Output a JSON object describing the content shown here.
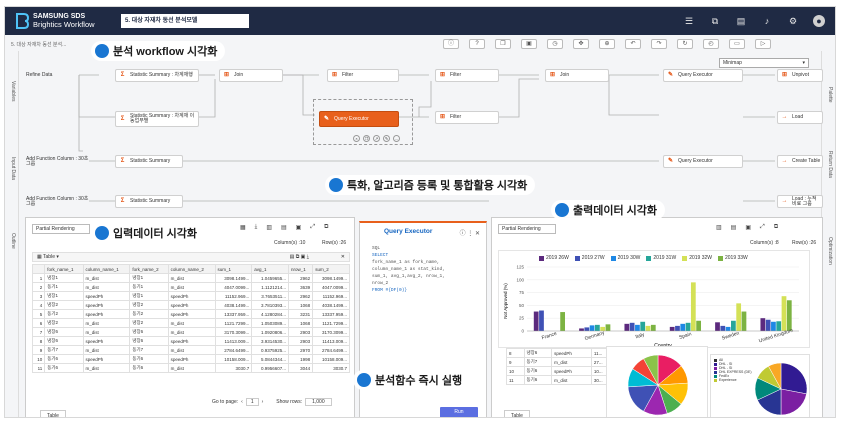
{
  "header": {
    "brand_line1": "SAMSUNG SDS",
    "brand_line2": "Brightics Workflow",
    "workflow_title": "5. 대상 자재차 동선 분석모델",
    "icons": [
      "grid-icon",
      "external-link-icon",
      "document-icon",
      "bell-icon",
      "settings-icon",
      "user-icon"
    ]
  },
  "breadcrumb": "5. 대상 자재차 동선 분석...",
  "minimap": {
    "label": "Minimap"
  },
  "side_left": [
    "Variables",
    "Input Data",
    "Outline"
  ],
  "side_right": [
    "Palette",
    "Return Data",
    "Optimization"
  ],
  "nodes": {
    "n1": "Refine Data",
    "n2": "Statistic Summary : 차계재행",
    "n3": "Join",
    "n4": "Filter",
    "n5": "Filter",
    "n6": "Join",
    "n7": "Query Executor",
    "n8": "Unpivot",
    "n9": "Statistic Summary : 차계재 이동업무별",
    "n10": "Query Executor",
    "n11": "Filter",
    "n12": "Load",
    "n13": "Add Function Column : 30초 그룹",
    "n14": "Statistic Summary",
    "n15": "Query Executor",
    "n16": "Create Table",
    "n17": "Add Function Column : 30초 그룹",
    "n18": "Statistic Summary",
    "n19": "Load : 누적 비료 그룹"
  },
  "banners": {
    "workflow": "분석 workflow 시각화",
    "algorithm": "특화, 알고리즘 등록 및 통합활용 시각화",
    "input": "입력데이터 시각화",
    "output": "출력데이터 시각화",
    "execute": "분석함수 즉시 실행"
  },
  "input_panel": {
    "render_mode": "Partial Rendering",
    "column_count": "Column(s) :10",
    "row_count": "Row(s) :26",
    "table_label": "Table",
    "columns": [
      "",
      "fork_name_1",
      "column_name_1",
      "fork_name_2",
      "column_name_2",
      "sum_1",
      "avg_1",
      "nrow_1",
      "sum_2"
    ],
    "rows": [
      [
        "1",
        "냉장1",
        "m_dist",
        "냉장1",
        "m_dist",
        "3098.1499...",
        "1.0459655...",
        "2962",
        "3098.1499..."
      ],
      [
        "2",
        "동기1",
        "m_dist",
        "동기1",
        "m_dist",
        "4047.0099...",
        "1.1121214...",
        "3639",
        "4047.0099..."
      ],
      [
        "3",
        "냉장1",
        "speedPh",
        "냉장1",
        "speedPh",
        "11152.969...",
        "3.7653511...",
        "2962",
        "11152.969..."
      ],
      [
        "4",
        "냉장2",
        "speedPh",
        "냉장2",
        "speedPh",
        "4038.1499...",
        "3.7810393...",
        "1068",
        "4038.1499..."
      ],
      [
        "5",
        "동기2",
        "speedPh",
        "동기2",
        "speedPh",
        "13337.959...",
        "4.1280284...",
        "3231",
        "13337.959..."
      ],
      [
        "6",
        "냉장2",
        "m_dist",
        "냉장2",
        "m_dist",
        "1121.7299...",
        "1.0503089...",
        "1068",
        "1121.7299..."
      ],
      [
        "7",
        "냉장6",
        "m_dist",
        "냉장6",
        "m_dist",
        "3170.3099...",
        "1.0920806...",
        "2903",
        "3170.3099..."
      ],
      [
        "8",
        "냉장6",
        "speedPh",
        "냉장6",
        "speedPh",
        "11413.009...",
        "3.9314530...",
        "2903",
        "11413.009..."
      ],
      [
        "9",
        "동기7",
        "m_dist",
        "동기7",
        "m_dist",
        "2784.6499...",
        "0.9375925...",
        "2970",
        "2784.6499..."
      ],
      [
        "10",
        "동기6",
        "speedPh",
        "동기6",
        "speedPh",
        "10158.009...",
        "5.0844344...",
        "1998",
        "10158.009..."
      ],
      [
        "11",
        "동기6",
        "m_dist",
        "동기6",
        "m_dist",
        "3030.7",
        "0.9956607...",
        "3044",
        "3030.7"
      ]
    ],
    "go_to_page": "Go to page:",
    "page": "1",
    "show_rows": "Show rows:",
    "show_rows_value": "1,000",
    "bottom_tab": "Table"
  },
  "query_panel": {
    "title": "Query Executor",
    "sql": [
      "SQL",
      "SELECT",
      "  fork_name_1 as fork_name,",
      "  column_name_1 as stat_kind,",
      "  sum_1, avg_1,avg_2, nrow_1,",
      "  nrow_2",
      "FROM #{DF(0)}"
    ],
    "run_label": "Run"
  },
  "output_panel": {
    "render_mode": "Partial Rendering",
    "column_count": "Column(s) :8",
    "row_count": "Row(s) :26",
    "bottom_tab": "Table",
    "bg_rows": [
      [
        "8",
        "냉장6",
        "speedPh",
        "11..."
      ],
      [
        "9",
        "동기7",
        "m_dist",
        "27..."
      ],
      [
        "10",
        "동기6",
        "speedPh",
        "10..."
      ],
      [
        "11",
        "동기6",
        "m_dist",
        "30..."
      ]
    ]
  },
  "colors": {
    "header_bg": "#1f2a44",
    "accent": "#e8601c",
    "banner_dot": "#1976d2"
  },
  "chart_data": [
    {
      "type": "bar",
      "categories": [
        "France",
        "Germany",
        "Italy",
        "Spain",
        "Sweden",
        "United Kingdom"
      ],
      "series": [
        {
          "name": "2019 26W",
          "values": [
            38,
            5,
            14,
            8,
            17,
            25
          ],
          "color": "#5c2a7e"
        },
        {
          "name": "2019 27W",
          "values": [
            40,
            7,
            16,
            10,
            10,
            22
          ],
          "color": "#3f51b5"
        },
        {
          "name": "2019 30W",
          "values": [
            0,
            11,
            12,
            14,
            8,
            18
          ],
          "color": "#1e88e5"
        },
        {
          "name": "2019 31W",
          "values": [
            0,
            12,
            18,
            16,
            20,
            19
          ],
          "color": "#26a69a"
        },
        {
          "name": "2019 32W",
          "values": [
            0,
            8,
            10,
            95,
            54,
            68
          ],
          "color": "#d4e157"
        },
        {
          "name": "2019 33W",
          "values": [
            37,
            13,
            12,
            20,
            38,
            60
          ],
          "color": "#7cb342"
        }
      ],
      "xlabel": "Country",
      "ylabel": "Not Approved (%)",
      "ylim": [
        0,
        125
      ],
      "yticks": [
        "0",
        "25",
        "50",
        "75",
        "100",
        "125"
      ],
      "grid": true,
      "legend": "top"
    },
    {
      "type": "pie",
      "values": [
        14,
        10,
        12,
        9,
        13,
        16,
        10,
        8,
        8
      ],
      "colors": [
        "#e91e63",
        "#ff9800",
        "#ffc107",
        "#4caf50",
        "#9c27b0",
        "#3f51b5",
        "#00bcd4",
        "#f44336",
        "#8bc34a"
      ]
    },
    {
      "type": "pie",
      "legend_labels": [
        "All",
        "DHL - SI",
        "DHL - SI",
        "DHL EXPRESS (DE)",
        "FedEx",
        "Experience"
      ],
      "values": [
        28,
        22,
        18,
        14,
        10,
        8
      ],
      "colors": [
        "#311b92",
        "#7b1fa2",
        "#283593",
        "#00897b",
        "#c0ca33",
        "#f9a825"
      ]
    }
  ]
}
